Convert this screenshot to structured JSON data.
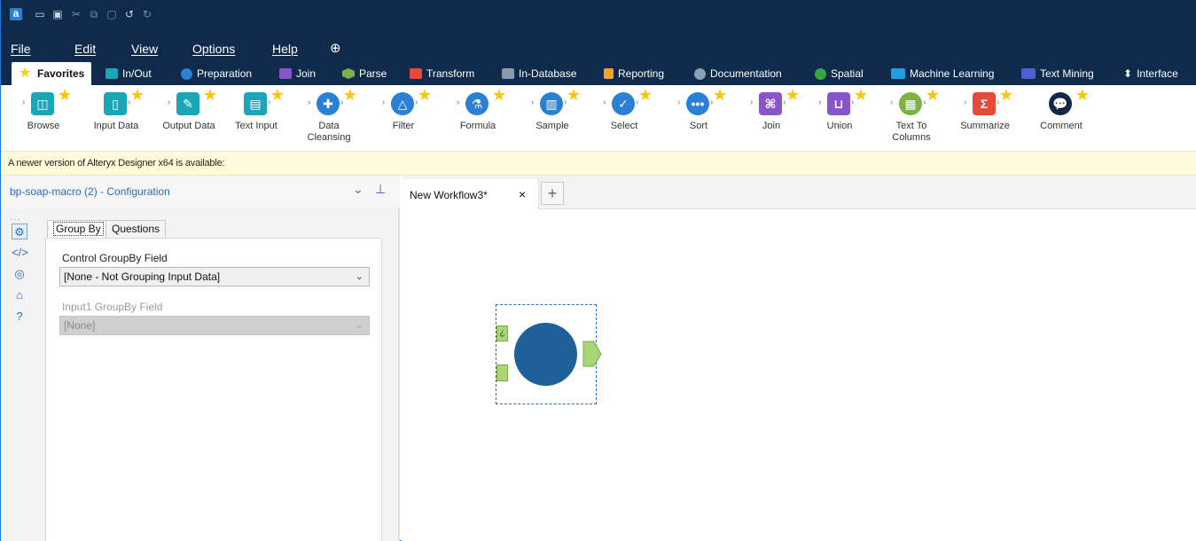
{
  "colors": {
    "title_bar": "#0f2a4a",
    "accent": "#2a6bbd",
    "notice_bg": "#fffcd9",
    "connector": "#a8d672",
    "macro_fill": "#1f5f9a"
  },
  "quick_access": [
    "logo",
    "new-icon",
    "open-icon",
    "save-icon",
    "cut-icon",
    "copy-icon",
    "paste-icon",
    "undo-icon",
    "redo-icon"
  ],
  "menu": {
    "file": "File",
    "edit": "Edit",
    "view": "View",
    "options": "Options",
    "help": "Help"
  },
  "ribbon_tabs": [
    {
      "label": "Favorites",
      "color": "#ffcd00"
    },
    {
      "label": "In/Out",
      "color": "#1aa6b7"
    },
    {
      "label": "Preparation",
      "color": "#2b7fd4"
    },
    {
      "label": "Join",
      "color": "#8a55c9"
    },
    {
      "label": "Parse",
      "color": "#7cb342"
    },
    {
      "label": "Transform",
      "color": "#e64a3b"
    },
    {
      "label": "In-Database",
      "color": "#8c9aab"
    },
    {
      "label": "Reporting",
      "color": "#f0a22b"
    },
    {
      "label": "Documentation",
      "color": "#8ca0b8"
    },
    {
      "label": "Spatial",
      "color": "#36a83f"
    },
    {
      "label": "Machine Learning",
      "color": "#1e9fe0"
    },
    {
      "label": "Text Mining",
      "color": "#4f5fd1"
    },
    {
      "label": "Interface",
      "color": "#ffffff"
    }
  ],
  "tools": [
    {
      "label": "Browse",
      "icon": "binoculars-icon",
      "color": "#1aa6b7"
    },
    {
      "label": "Input Data",
      "icon": "book-icon",
      "color": "#1aa6b7"
    },
    {
      "label": "Output Data",
      "icon": "book-out-icon",
      "color": "#1aa6b7"
    },
    {
      "label": "Text Input",
      "icon": "text-book-icon",
      "color": "#1aa6b7"
    },
    {
      "label": "Data\nCleansing",
      "icon": "cleanse-icon",
      "color": "#2b7fd4"
    },
    {
      "label": "Filter",
      "icon": "filter-icon",
      "color": "#2b7fd4"
    },
    {
      "label": "Formula",
      "icon": "flask-icon",
      "color": "#2b7fd4"
    },
    {
      "label": "Sample",
      "icon": "sample-icon",
      "color": "#2b7fd4"
    },
    {
      "label": "Select",
      "icon": "check-icon",
      "color": "#2b7fd4"
    },
    {
      "label": "Sort",
      "icon": "sort-icon",
      "color": "#2b7fd4"
    },
    {
      "label": "Join",
      "icon": "join-icon",
      "color": "#8a55c9"
    },
    {
      "label": "Union",
      "icon": "union-icon",
      "color": "#8a55c9"
    },
    {
      "label": "Text To\nColumns",
      "icon": "text-columns-icon",
      "color": "#7cb342"
    },
    {
      "label": "Summarize",
      "icon": "sigma-icon",
      "color": "#e64a3b"
    },
    {
      "label": "Comment",
      "icon": "comment-icon",
      "color": "#0f2a4a"
    }
  ],
  "notice": "A newer version of Alteryx Designer x64 is available:",
  "config": {
    "title": "bp-soap-macro (2) - Configuration",
    "tabs": [
      "Group By",
      "Questions"
    ],
    "control_label": "Control GroupBy Field",
    "control_value": "[None - Not Grouping Input Data]",
    "input1_label": "Input1 GroupBy Field",
    "input1_value": "[None]"
  },
  "workflow": {
    "tab_name": "New Workflow3*",
    "close_glyph": "×",
    "add_glyph": "+",
    "input_anchor_label": "¿"
  }
}
